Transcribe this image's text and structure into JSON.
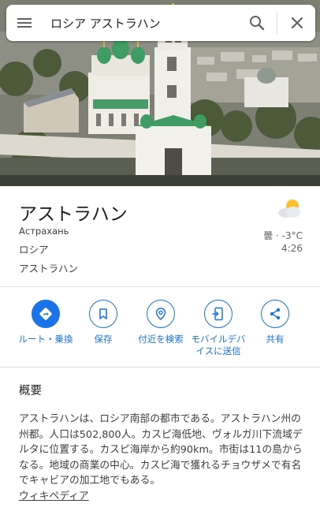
{
  "search": {
    "query": "ロシア アストラハン",
    "menu_icon": "hamburger-menu-icon",
    "search_icon": "search-icon",
    "close_icon": "close-icon"
  },
  "hero": {
    "image_name": "astrakhan-kremlin-photo"
  },
  "place": {
    "name": "アストラハン",
    "native_name": "Астрахань",
    "country": "ロシア",
    "region": "アストラハン"
  },
  "weather": {
    "icon": "partly-cloudy-icon",
    "condition": "曇 · -3°C",
    "time": "4:26"
  },
  "actions": [
    {
      "label": "ルート・乗換",
      "icon": "directions-icon"
    },
    {
      "label": "保存",
      "icon": "bookmark-icon"
    },
    {
      "label": "付近を検索",
      "icon": "nearby-pin-icon"
    },
    {
      "label": "モバイルデバイスに送信",
      "icon": "send-to-device-icon"
    },
    {
      "label": "共有",
      "icon": "share-icon"
    }
  ],
  "overview": {
    "title": "概要",
    "text": "アストラハンは、ロシア南部の都市である。アストラハン州の州都。人口は502,800人。カスピ海低地、ヴォルガ川下流域デルタに位置する。カスピ海岸から約90km。市街は11の島からなる。地域の商業の中心。カスピ海で獲れるチョウザメで有名でキャビアの加工地でもある。",
    "source_link": "ウィキペディア"
  },
  "colors": {
    "accent": "#1a73e8",
    "text_primary": "#202124",
    "text_secondary": "#5f6368",
    "divider": "#e0e0e0"
  }
}
